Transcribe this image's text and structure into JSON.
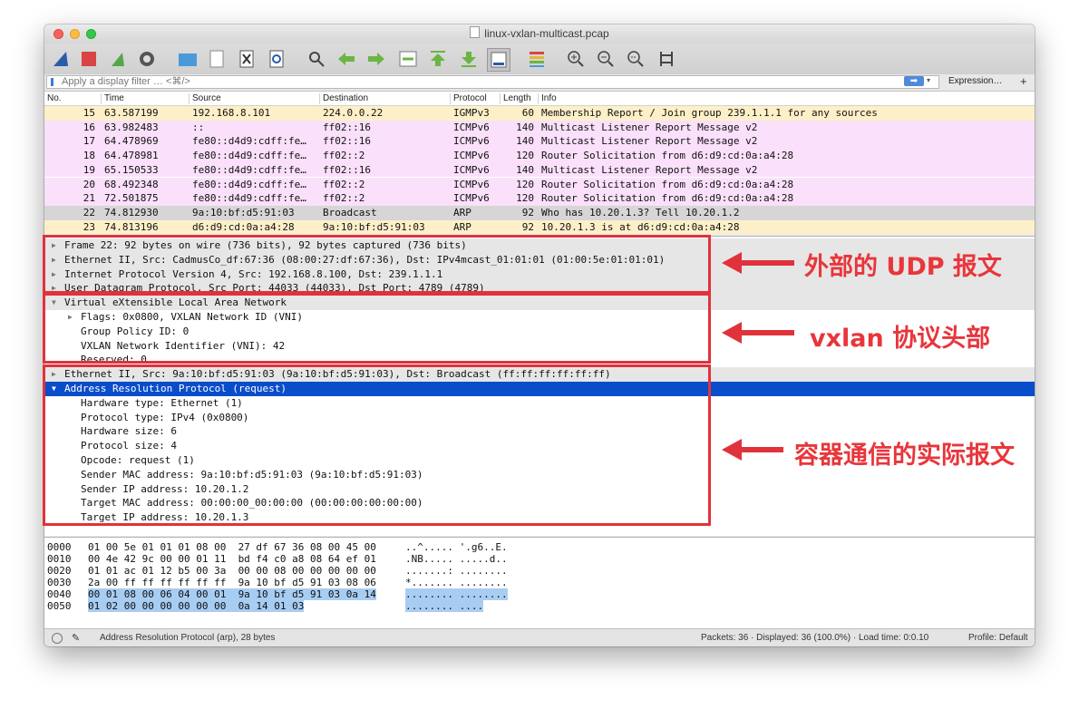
{
  "window": {
    "title": "linux-vxlan-multicast.pcap"
  },
  "filter": {
    "placeholder": "Apply a display filter … <⌘/>",
    "expression_label": "Expression…",
    "add_label": "+"
  },
  "packet_list": {
    "headers": {
      "no": "No.",
      "time": "Time",
      "source": "Source",
      "destination": "Destination",
      "protocol": "Protocol",
      "length": "Length",
      "info": "Info"
    },
    "rows": [
      {
        "no": "15",
        "time": "63.587199",
        "source": "192.168.8.101",
        "destination": "224.0.0.22",
        "protocol": "IGMPv3",
        "length": "60",
        "info": "Membership Report / Join group 239.1.1.1 for any sources",
        "color": "#fdf0c9"
      },
      {
        "no": "16",
        "time": "63.982483",
        "source": "::",
        "destination": "ff02::16",
        "protocol": "ICMPv6",
        "length": "140",
        "info": "Multicast Listener Report Message v2",
        "color": "#fae0fa"
      },
      {
        "no": "17",
        "time": "64.478969",
        "source": "fe80::d4d9:cdff:fe…",
        "destination": "ff02::16",
        "protocol": "ICMPv6",
        "length": "140",
        "info": "Multicast Listener Report Message v2",
        "color": "#fae0fa"
      },
      {
        "no": "18",
        "time": "64.478981",
        "source": "fe80::d4d9:cdff:fe…",
        "destination": "ff02::2",
        "protocol": "ICMPv6",
        "length": "120",
        "info": "Router Solicitation from d6:d9:cd:0a:a4:28",
        "color": "#fae0fa"
      },
      {
        "no": "19",
        "time": "65.150533",
        "source": "fe80::d4d9:cdff:fe…",
        "destination": "ff02::16",
        "protocol": "ICMPv6",
        "length": "140",
        "info": "Multicast Listener Report Message v2",
        "color": "#fae0fa"
      },
      {
        "no": "20",
        "time": "68.492348",
        "source": "fe80::d4d9:cdff:fe…",
        "destination": "ff02::2",
        "protocol": "ICMPv6",
        "length": "120",
        "info": "Router Solicitation from d6:d9:cd:0a:a4:28",
        "color": "#fae0fa"
      },
      {
        "no": "21",
        "time": "72.501875",
        "source": "fe80::d4d9:cdff:fe…",
        "destination": "ff02::2",
        "protocol": "ICMPv6",
        "length": "120",
        "info": "Router Solicitation from d6:d9:cd:0a:a4:28",
        "color": "#fae0fa"
      },
      {
        "no": "22",
        "time": "74.812930",
        "source": "9a:10:bf:d5:91:03",
        "destination": "Broadcast",
        "protocol": "ARP",
        "length": "92",
        "info": "Who has 10.20.1.3? Tell 10.20.1.2",
        "color": "#d6d6d6"
      },
      {
        "no": "23",
        "time": "74.813196",
        "source": "d6:d9:cd:0a:a4:28",
        "destination": "9a:10:bf:d5:91:03",
        "protocol": "ARP",
        "length": "92",
        "info": "10.20.1.3 is at d6:d9:cd:0a:a4:28",
        "color": "#fdf0c9"
      }
    ]
  },
  "details": [
    {
      "text": "Frame 22: 92 bytes on wire (736 bits), 92 bytes captured (736 bits)",
      "tri": "▶",
      "level": 0,
      "style": "grey"
    },
    {
      "text": "Ethernet II, Src: CadmusCo_df:67:36 (08:00:27:df:67:36), Dst: IPv4mcast_01:01:01 (01:00:5e:01:01:01)",
      "tri": "▶",
      "level": 0,
      "style": "grey"
    },
    {
      "text": "Internet Protocol Version 4, Src: 192.168.8.100, Dst: 239.1.1.1",
      "tri": "▶",
      "level": 0,
      "style": "grey"
    },
    {
      "text": "User Datagram Protocol, Src Port: 44033 (44033), Dst Port: 4789 (4789)",
      "tri": "▶",
      "level": 0,
      "style": "grey"
    },
    {
      "text": "Virtual eXtensible Local Area Network",
      "tri": "▼",
      "level": 0,
      "style": "grey"
    },
    {
      "text": "Flags: 0x0800, VXLAN Network ID (VNI)",
      "tri": "▶",
      "level": 1,
      "style": ""
    },
    {
      "text": "Group Policy ID: 0",
      "tri": "",
      "level": 2,
      "style": ""
    },
    {
      "text": "VXLAN Network Identifier (VNI): 42",
      "tri": "",
      "level": 2,
      "style": ""
    },
    {
      "text": "Reserved: 0",
      "tri": "",
      "level": 2,
      "style": ""
    },
    {
      "text": "Ethernet II, Src: 9a:10:bf:d5:91:03 (9a:10:bf:d5:91:03), Dst: Broadcast (ff:ff:ff:ff:ff:ff)",
      "tri": "▶",
      "level": 0,
      "style": "grey"
    },
    {
      "text": "Address Resolution Protocol (request)",
      "tri": "▼",
      "level": 0,
      "style": "sel"
    },
    {
      "text": "Hardware type: Ethernet (1)",
      "tri": "",
      "level": 2,
      "style": ""
    },
    {
      "text": "Protocol type: IPv4 (0x0800)",
      "tri": "",
      "level": 2,
      "style": ""
    },
    {
      "text": "Hardware size: 6",
      "tri": "",
      "level": 2,
      "style": ""
    },
    {
      "text": "Protocol size: 4",
      "tri": "",
      "level": 2,
      "style": ""
    },
    {
      "text": "Opcode: request (1)",
      "tri": "",
      "level": 2,
      "style": ""
    },
    {
      "text": "Sender MAC address: 9a:10:bf:d5:91:03 (9a:10:bf:d5:91:03)",
      "tri": "",
      "level": 2,
      "style": ""
    },
    {
      "text": "Sender IP address: 10.20.1.2",
      "tri": "",
      "level": 2,
      "style": ""
    },
    {
      "text": "Target MAC address: 00:00:00_00:00:00 (00:00:00:00:00:00)",
      "tri": "",
      "level": 2,
      "style": ""
    },
    {
      "text": "Target IP address: 10.20.1.3",
      "tri": "",
      "level": 2,
      "style": ""
    }
  ],
  "hex": [
    {
      "offset": "0000",
      "bytes": "01 00 5e 01 01 01 08 00  27 df 67 36 08 00 45 00",
      "ascii": "..^..... '.g6..E.",
      "hl_bytes": "",
      "hl_ascii": ""
    },
    {
      "offset": "0010",
      "bytes": "00 4e 42 9c 00 00 01 11  bd f4 c0 a8 08 64 ef 01",
      "ascii": ".NB..... .....d..",
      "hl_bytes": "",
      "hl_ascii": ""
    },
    {
      "offset": "0020",
      "bytes": "01 01 ac 01 12 b5 00 3a  00 00 08 00 00 00 00 00",
      "ascii": ".......: ........",
      "hl_bytes": "",
      "hl_ascii": ""
    },
    {
      "offset": "0030",
      "bytes": "2a 00 ff ff ff ff ff ff  9a 10 bf d5 91 03 08 06",
      "ascii": "*....... ........",
      "hl_bytes": "",
      "hl_ascii": ""
    },
    {
      "offset": "0040",
      "bytes": "",
      "ascii": "",
      "hl_bytes": "00 01 08 00 06 04 00 01  9a 10 bf d5 91 03 0a 14",
      "hl_ascii": "........ ........"
    },
    {
      "offset": "0050",
      "bytes": "",
      "ascii": "",
      "hl_bytes": "01 02 00 00 00 00 00 00  0a 14 01 03",
      "hl_ascii": "........ ...."
    }
  ],
  "status": {
    "left": "Address Resolution Protocol (arp), 28 bytes",
    "mid": "Packets: 36 · Displayed: 36 (100.0%) · Load time: 0:0.10",
    "right": "Profile: Default"
  },
  "annotations": {
    "outer_udp": "外部的 UDP 报文",
    "vxlan_header": "vxlan 协议头部",
    "container_packet": "容器通信的实际报文"
  },
  "colors": {
    "selection": "#0a4dcb",
    "annotation_red": "#e0323b"
  }
}
